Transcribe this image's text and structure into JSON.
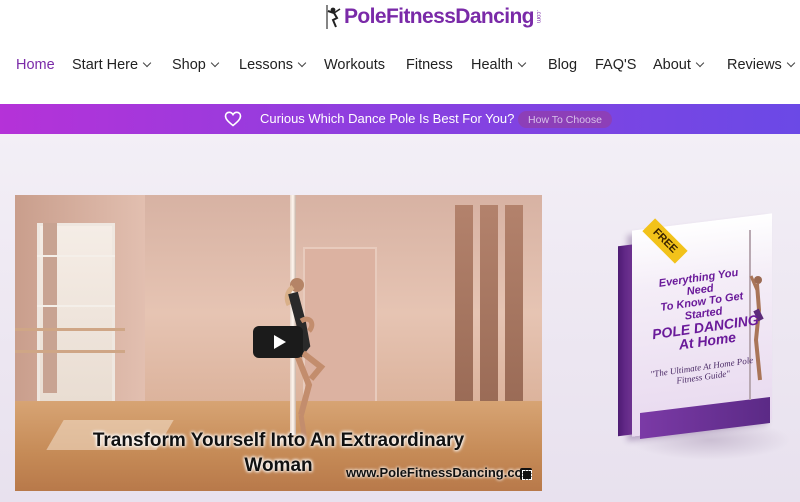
{
  "header": {
    "logo_text": "PoleFitnessDancing",
    "logo_suffix": ".com"
  },
  "nav": {
    "items": [
      {
        "label": "Home",
        "active": true,
        "dropdown": false
      },
      {
        "label": "Start Here",
        "dropdown": true
      },
      {
        "label": "Shop",
        "dropdown": true
      },
      {
        "label": "Lessons",
        "dropdown": true
      },
      {
        "label": "Workouts",
        "dropdown": false
      },
      {
        "label": "Fitness",
        "dropdown": false
      },
      {
        "label": "Health",
        "dropdown": true
      },
      {
        "label": "Blog",
        "dropdown": false
      },
      {
        "label": "FAQ'S",
        "dropdown": false
      },
      {
        "label": "About",
        "dropdown": true
      },
      {
        "label": "Reviews",
        "dropdown": true
      }
    ]
  },
  "banner": {
    "text": "Curious Which Dance Pole Is Best For You?",
    "button_label": "How To Choose",
    "icon": "heart-icon"
  },
  "video": {
    "caption_line1": "Transform Yourself Into An Extraordinary",
    "caption_line2": "Woman",
    "watermark": "www.PoleFitnessDancing.co",
    "play_icon": "play-icon",
    "fullscreen_icon": "fullscreen-icon"
  },
  "ebook": {
    "tag": "FREE",
    "title_line1": "Everything You Need",
    "title_line2": "To Know To Get Started",
    "title_big1": "POLE DANCING",
    "title_line3": "At Home",
    "subtitle": "\"The Ultimate At Home Pole Fitness Guide\""
  },
  "colors": {
    "accent": "#7a2aa8",
    "banner_start": "#b532d8",
    "banner_end": "#6b49e6",
    "button": "#8d3fb8"
  }
}
